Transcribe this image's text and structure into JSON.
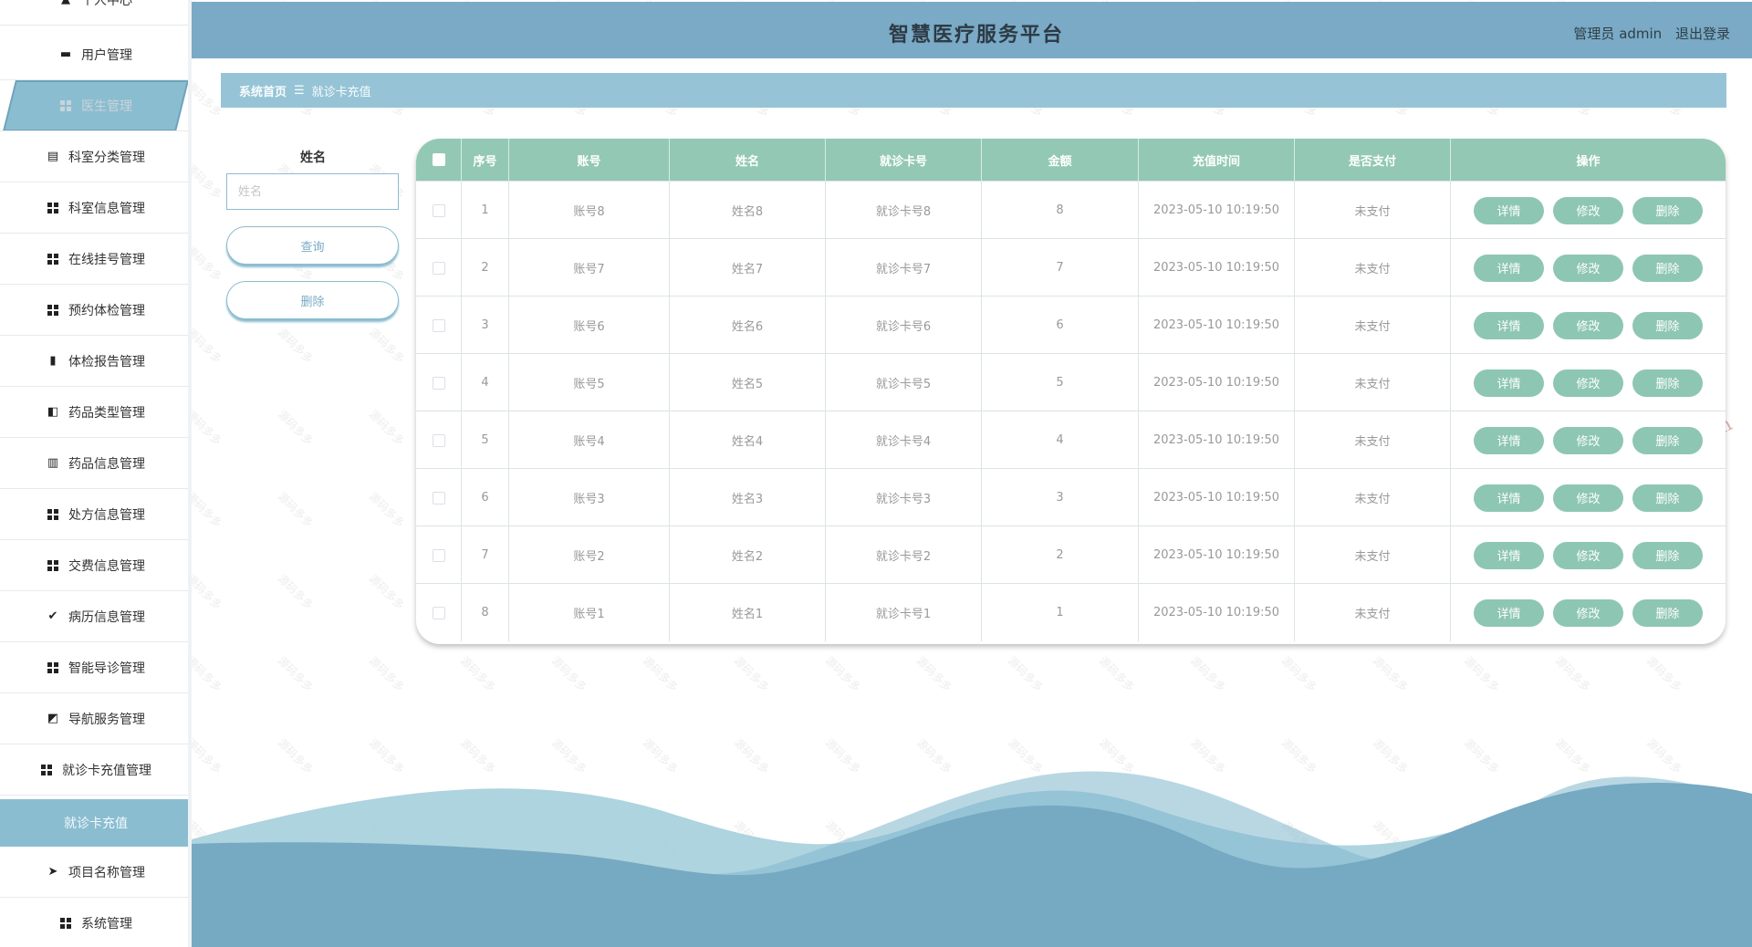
{
  "header": {
    "title": "智慧医疗服务平台",
    "user": "管理员 admin",
    "logout": "退出登录"
  },
  "sidebar": {
    "top_partial": "个人中心",
    "items": [
      {
        "label": "用户管理",
        "icon": "briefcase-icon"
      },
      {
        "label": "医生管理",
        "icon": "grid-icon"
      },
      {
        "label": "科室分类管理",
        "icon": "clipboard-icon"
      },
      {
        "label": "科室信息管理",
        "icon": "grid-icon"
      },
      {
        "label": "在线挂号管理",
        "icon": "grid-icon"
      },
      {
        "label": "预约体检管理",
        "icon": "grid-icon"
      },
      {
        "label": "体检报告管理",
        "icon": "bar-chart-icon"
      },
      {
        "label": "药品类型管理",
        "icon": "ticket-icon"
      },
      {
        "label": "药品信息管理",
        "icon": "books-icon"
      },
      {
        "label": "处方信息管理",
        "icon": "grid-icon"
      },
      {
        "label": "交费信息管理",
        "icon": "grid-icon"
      },
      {
        "label": "病历信息管理",
        "icon": "clipboard-check-icon"
      },
      {
        "label": "智能导诊管理",
        "icon": "grid-icon"
      },
      {
        "label": "导航服务管理",
        "icon": "line-chart-icon"
      },
      {
        "label": "就诊卡充值管理",
        "icon": "grid-icon"
      },
      {
        "label": "项目名称管理",
        "icon": "send-icon"
      },
      {
        "label": "系统管理",
        "icon": "grid-icon"
      }
    ],
    "active_sub": "就诊卡充值"
  },
  "breadcrumb": {
    "home": "系统首页",
    "separator": "☰",
    "current": "就诊卡充值"
  },
  "search": {
    "label": "姓名",
    "placeholder": "姓名",
    "query_button": "查询",
    "delete_button": "删除"
  },
  "table": {
    "headers": [
      "",
      "序号",
      "账号",
      "姓名",
      "就诊卡号",
      "金额",
      "充值时间",
      "是否支付",
      "操作"
    ],
    "actions": [
      "详情",
      "修改",
      "删除"
    ],
    "rows": [
      {
        "idx": "1",
        "account": "账号8",
        "name": "姓名8",
        "card": "就诊卡号8",
        "amount": "8",
        "time": "2023-05-10 10:19:50",
        "paid": "未支付"
      },
      {
        "idx": "2",
        "account": "账号7",
        "name": "姓名7",
        "card": "就诊卡号7",
        "amount": "7",
        "time": "2023-05-10 10:19:50",
        "paid": "未支付"
      },
      {
        "idx": "3",
        "account": "账号6",
        "name": "姓名6",
        "card": "就诊卡号6",
        "amount": "6",
        "time": "2023-05-10 10:19:50",
        "paid": "未支付"
      },
      {
        "idx": "4",
        "account": "账号5",
        "name": "姓名5",
        "card": "就诊卡号5",
        "amount": "5",
        "time": "2023-05-10 10:19:50",
        "paid": "未支付"
      },
      {
        "idx": "5",
        "account": "账号4",
        "name": "姓名4",
        "card": "就诊卡号4",
        "amount": "4",
        "time": "2023-05-10 10:19:50",
        "paid": "未支付"
      },
      {
        "idx": "6",
        "account": "账号3",
        "name": "姓名3",
        "card": "就诊卡号3",
        "amount": "3",
        "time": "2023-05-10 10:19:50",
        "paid": "未支付"
      },
      {
        "idx": "7",
        "account": "账号2",
        "name": "姓名2",
        "card": "就诊卡号2",
        "amount": "2",
        "time": "2023-05-10 10:19:50",
        "paid": "未支付"
      },
      {
        "idx": "8",
        "account": "账号1",
        "name": "姓名1",
        "card": "就诊卡号1",
        "amount": "1",
        "time": "2023-05-10 10:19:50",
        "paid": "未支付"
      }
    ]
  },
  "watermark": {
    "text": "源码多多",
    "url": "www.code386.com"
  },
  "colors": {
    "header": "#7aaac5",
    "accent": "#8bbdd0",
    "table_header": "#93c8b5",
    "action_button": "#8ec6b4"
  }
}
